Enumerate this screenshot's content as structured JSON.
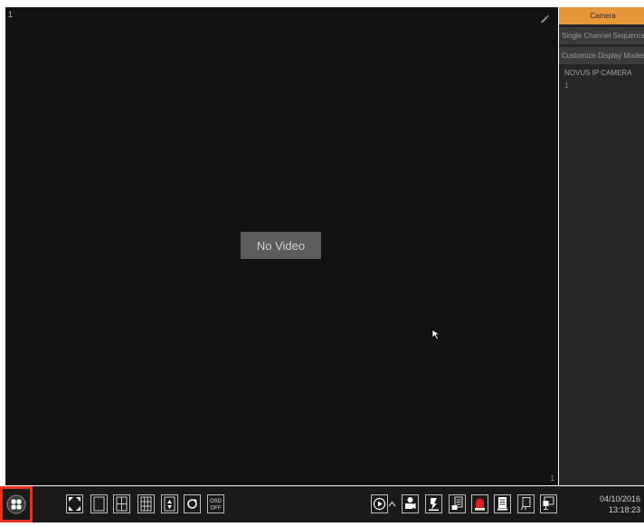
{
  "video": {
    "channel_number": "1",
    "channel_number_corner": "1",
    "no_video_label": "No Video"
  },
  "panel": {
    "tabs": {
      "camera": "Camera",
      "sequence": "Single Channel Sequence",
      "custom": "Customize Display Modes"
    },
    "group_name": "NOVUS IP CAMERA",
    "items": [
      "1"
    ]
  },
  "toolbar": {
    "osd_line1": "OSD",
    "osd_line2": "OFF",
    "highlight_color": "#e8321e"
  },
  "status": {
    "date": "04/10/2016",
    "time": "13:18:23"
  }
}
